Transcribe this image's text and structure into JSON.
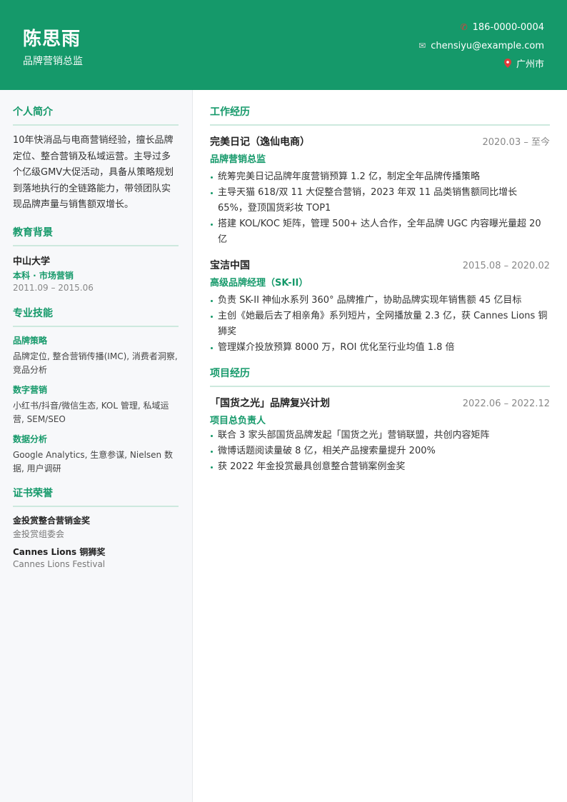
{
  "header": {
    "name": "陈思雨",
    "title": "品牌营销总监",
    "phone": "186-0000-0004",
    "email": "chensiyu@example.com",
    "location": "广州市",
    "phone_icon": "phone-icon",
    "email_icon": "envelope-icon",
    "location_icon": "map-pin-icon"
  },
  "colors": {
    "accent": "#15996a",
    "sidebar_bg": "#f7f8fa"
  },
  "sidebar": {
    "summary": {
      "title": "个人简介",
      "text": "10年快消品与电商营销经验，擅长品牌定位、整合营销及私域运营。主导过多个亿级GMV大促活动，具备从策略规划到落地执行的全链路能力，带领团队实现品牌声量与销售额双增长。"
    },
    "education": {
      "title": "教育背景",
      "school": "中山大学",
      "degree": "本科 · 市场营销",
      "date": "2011.09 – 2015.06"
    },
    "skills": {
      "title": "专业技能",
      "groups": [
        {
          "name": "品牌策略",
          "items": "品牌定位, 整合营销传播(IMC), 消费者洞察, 竞品分析"
        },
        {
          "name": "数字营销",
          "items": "小红书/抖音/微信生态, KOL 管理, 私域运营, SEM/SEO"
        },
        {
          "name": "数据分析",
          "items": "Google Analytics, 生意参谋, Nielsen 数据, 用户调研"
        }
      ]
    },
    "certs": {
      "title": "证书荣誉",
      "items": [
        {
          "name": "金投赏整合营销金奖",
          "org": "金投赏组委会"
        },
        {
          "name": "Cannes Lions 铜狮奖",
          "org": "Cannes Lions Festival"
        }
      ]
    }
  },
  "main": {
    "work": {
      "title": "工作经历",
      "jobs": [
        {
          "company": "完美日记（逸仙电商）",
          "date": "2020.03 – 至今",
          "role": "品牌营销总监",
          "bullets": [
            "统筹完美日记品牌年度营销预算 1.2 亿，制定全年品牌传播策略",
            "主导天猫 618/双 11 大促整合营销，2023 年双 11 品类销售额同比增长 65%，登顶国货彩妆 TOP1",
            "搭建 KOL/KOC 矩阵，管理 500+ 达人合作，全年品牌 UGC 内容曝光量超 20 亿"
          ]
        },
        {
          "company": "宝洁中国",
          "date": "2015.08 – 2020.02",
          "role": "高级品牌经理（SK-II）",
          "bullets": [
            "负责 SK-II 神仙水系列 360° 品牌推广，协助品牌实现年销售额 45 亿目标",
            "主创《她最后去了相亲角》系列短片，全网播放量 2.3 亿，获 Cannes Lions 铜狮奖",
            "管理媒介投放预算 8000 万，ROI 优化至行业均值 1.8 倍"
          ]
        }
      ]
    },
    "projects": {
      "title": "项目经历",
      "items": [
        {
          "name": "「国货之光」品牌复兴计划",
          "date": "2022.06 – 2022.12",
          "role": "项目总负责人",
          "bullets": [
            "联合 3 家头部国货品牌发起「国货之光」营销联盟，共创内容矩阵",
            "微博话题阅读量破 8 亿，相关产品搜索量提升 200%",
            "获 2022 年金投赏最具创意整合营销案例金奖"
          ]
        }
      ]
    }
  }
}
